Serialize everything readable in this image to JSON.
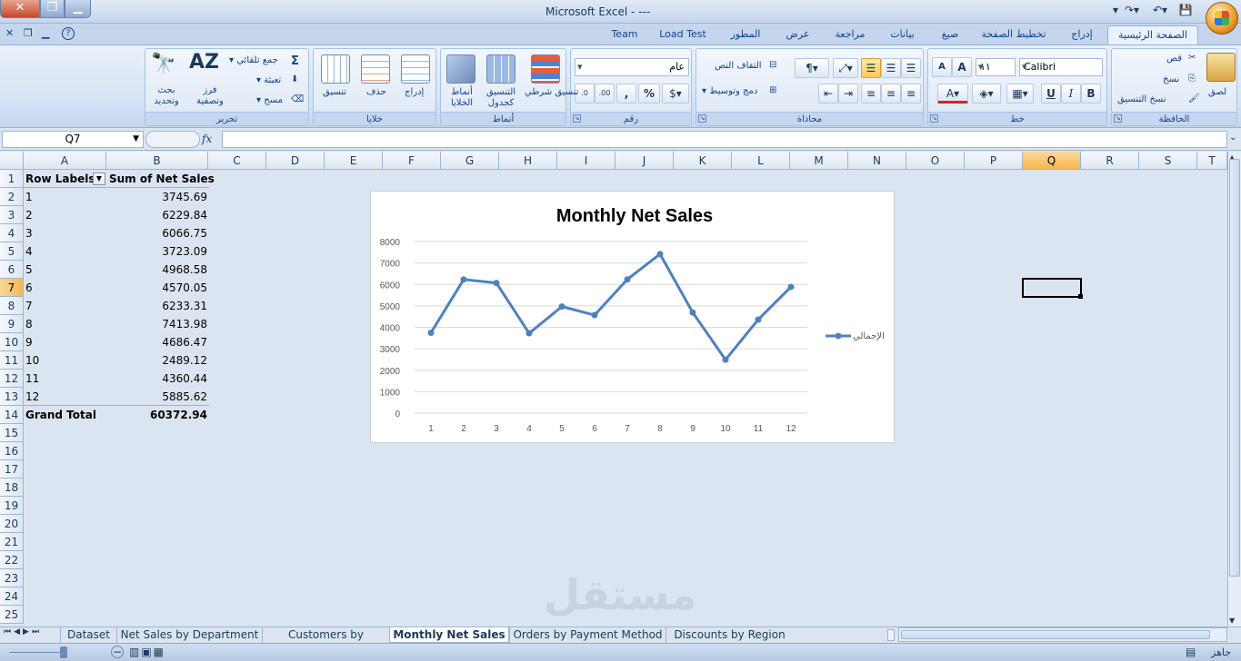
{
  "app": {
    "title": "Microsoft Excel - ---"
  },
  "tabs": [
    "الصفحة الرئيسية",
    "إدراج",
    "تخطيط الصفحة",
    "صيغ",
    "بيانات",
    "مراجعة",
    "عرض",
    "المطور",
    "Load Test",
    "Team"
  ],
  "clipboard": {
    "label": "الحافظة",
    "paste": "لصق",
    "cut": "قص",
    "copy": "نسخ",
    "format_painter": "نسخ التنسيق"
  },
  "font": {
    "label": "خط",
    "name": "Calibri",
    "size": "١١",
    "bold": "B",
    "italic": "I",
    "underline": "U"
  },
  "alignment": {
    "label": "محاذاة",
    "wrap": "التفاف النص",
    "merge": "دمج وتوسيط"
  },
  "number": {
    "label": "رقم",
    "format": "عام",
    "percent": "%",
    "comma": ","
  },
  "styles": {
    "label": "أنماط",
    "conditional": "تنسيق شرطي",
    "as_table": "التنسيق كجدول",
    "cell_styles": "أنماط الخلايا"
  },
  "cells": {
    "label": "خلايا",
    "insert": "إدراج",
    "delete": "حذف",
    "format": "تنسيق"
  },
  "editing": {
    "label": "تحرير",
    "autosum": "جمع تلقائي",
    "fill": "تعبئة",
    "clear": "مسح",
    "sort": "فرز وتصفية",
    "find": "بحث وتحديد"
  },
  "formula_bar": {
    "name_box": "Q7",
    "fx": "fx",
    "value": ""
  },
  "columns": [
    "A",
    "B",
    "C",
    "D",
    "E",
    "F",
    "G",
    "H",
    "I",
    "J",
    "K",
    "L",
    "M",
    "N",
    "O",
    "P",
    "Q",
    "R",
    "S",
    "T"
  ],
  "rows": [
    "1",
    "2",
    "3",
    "4",
    "5",
    "6",
    "7",
    "8",
    "9",
    "10",
    "11",
    "12",
    "13",
    "14",
    "15",
    "16",
    "17",
    "18",
    "19",
    "20",
    "21",
    "22",
    "23",
    "24",
    "25"
  ],
  "pivot": {
    "header_labels": "Row Labels",
    "header_values": "Sum of Net Sales",
    "labels": [
      "1",
      "2",
      "3",
      "4",
      "5",
      "6",
      "7",
      "8",
      "9",
      "10",
      "11",
      "12"
    ],
    "values": [
      "3745.69",
      "6229.84",
      "6066.75",
      "3723.09",
      "4968.58",
      "4570.05",
      "6233.31",
      "7413.98",
      "4686.47",
      "2489.12",
      "4360.44",
      "5885.62"
    ],
    "total_label": "Grand Total",
    "total_value": "60372.94"
  },
  "chart_data": {
    "type": "line",
    "title": "Monthly Net Sales",
    "categories": [
      "1",
      "2",
      "3",
      "4",
      "5",
      "6",
      "7",
      "8",
      "9",
      "10",
      "11",
      "12"
    ],
    "series": [
      {
        "name": "الإجمالي",
        "values": [
          3745.69,
          6229.84,
          6066.75,
          3723.09,
          4968.58,
          4570.05,
          6233.31,
          7413.98,
          4686.47,
          2489.12,
          4360.44,
          5885.62
        ],
        "color": "#4f81bd"
      }
    ],
    "ylim": [
      0,
      8000
    ],
    "yticks": [
      "0",
      "1000",
      "2000",
      "3000",
      "4000",
      "5000",
      "6000",
      "7000",
      "8000"
    ],
    "grid": true,
    "legend": "right"
  },
  "sheet_tabs": [
    "Dataset",
    "Net Sales by Department and Cat",
    "Customers by Revenue",
    "Monthly Net Sales",
    "Orders by Payment Method",
    "Discounts by Region"
  ],
  "status": {
    "ready": "جاهز"
  },
  "watermark": "مستقل"
}
